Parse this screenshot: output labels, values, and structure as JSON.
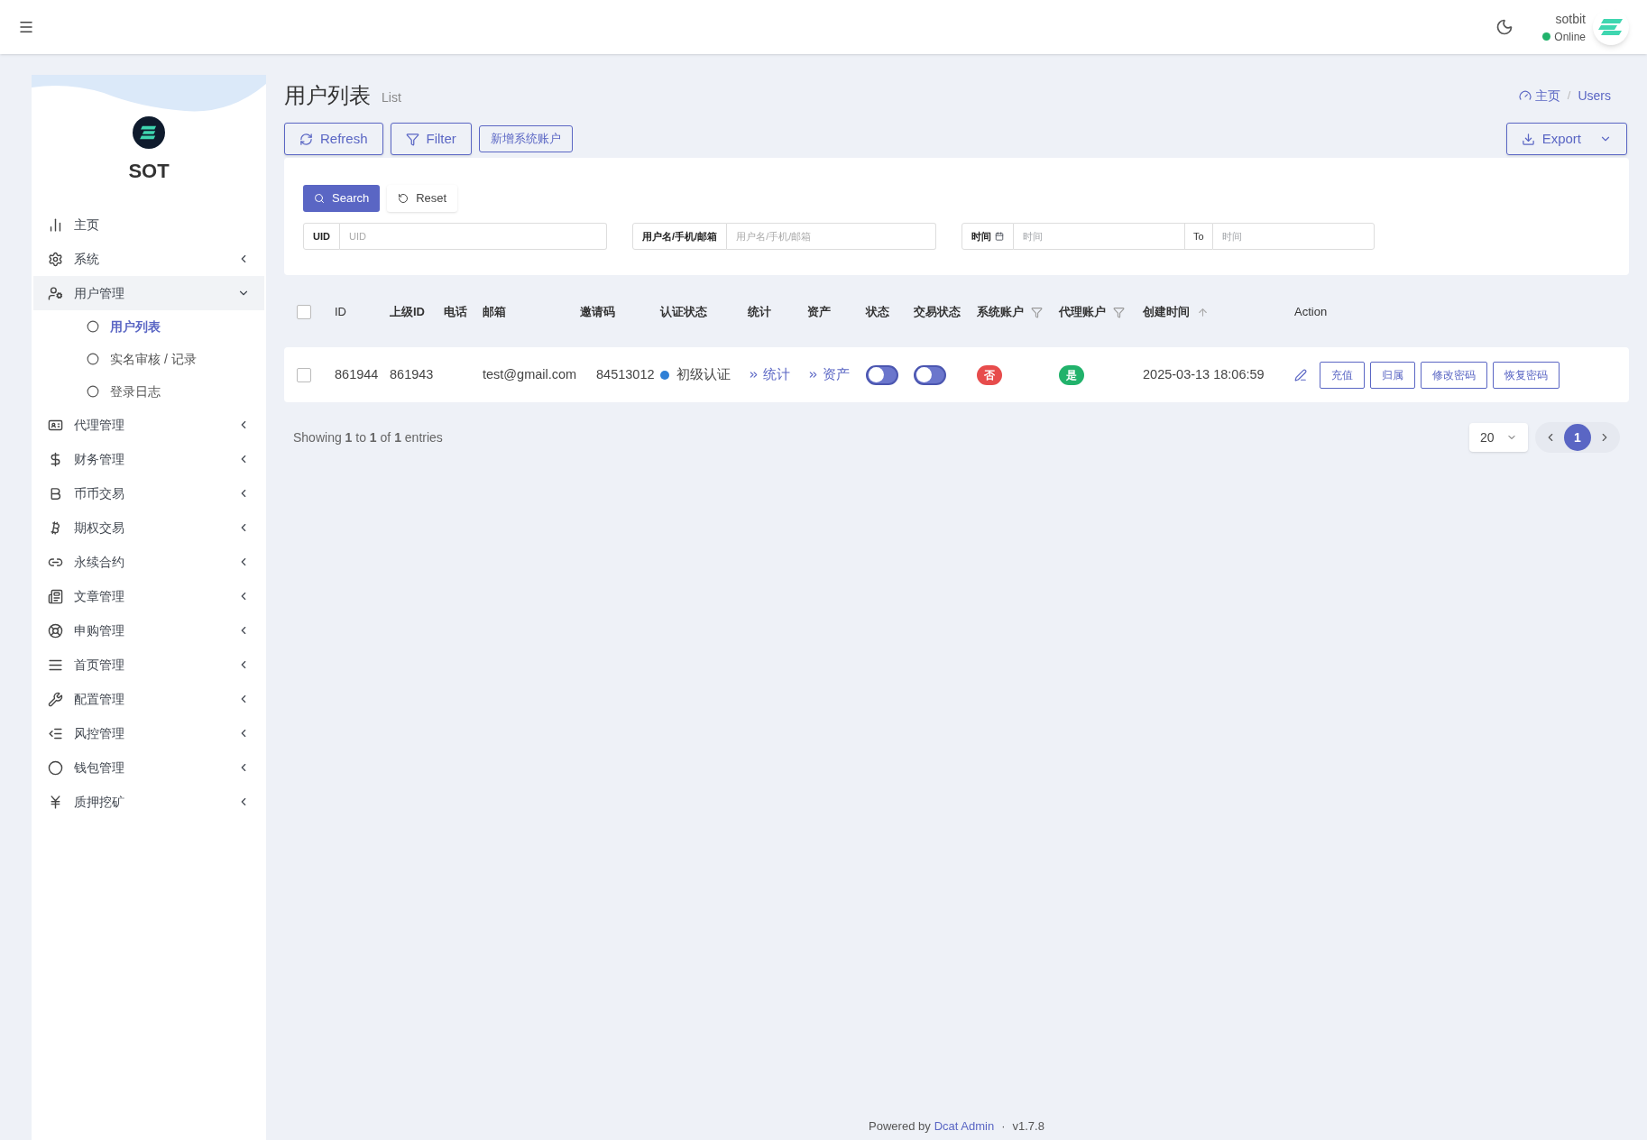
{
  "header": {
    "user_name": "sotbit",
    "user_status": "Online",
    "online": true
  },
  "sidebar": {
    "brand": "SOT",
    "items": [
      {
        "label": "主页",
        "has_children": false,
        "expanded": false,
        "selected": false
      },
      {
        "label": "系统",
        "has_children": true,
        "expanded": false,
        "selected": false
      },
      {
        "label": "用户管理",
        "has_children": true,
        "expanded": true,
        "selected": false,
        "children": [
          {
            "label": "用户列表",
            "selected": true
          },
          {
            "label": "实名审核 / 记录",
            "selected": false
          },
          {
            "label": "登录日志",
            "selected": false
          }
        ]
      },
      {
        "label": "代理管理",
        "has_children": true,
        "expanded": false,
        "selected": false
      },
      {
        "label": "财务管理",
        "has_children": true,
        "expanded": false,
        "selected": false
      },
      {
        "label": "币币交易",
        "has_children": true,
        "expanded": false,
        "selected": false
      },
      {
        "label": "期权交易",
        "has_children": true,
        "expanded": false,
        "selected": false
      },
      {
        "label": "永续合约",
        "has_children": true,
        "expanded": false,
        "selected": false
      },
      {
        "label": "文章管理",
        "has_children": true,
        "expanded": false,
        "selected": false
      },
      {
        "label": "申购管理",
        "has_children": true,
        "expanded": false,
        "selected": false
      },
      {
        "label": "首页管理",
        "has_children": true,
        "expanded": false,
        "selected": false
      },
      {
        "label": "配置管理",
        "has_children": true,
        "expanded": false,
        "selected": false
      },
      {
        "label": "风控管理",
        "has_children": true,
        "expanded": false,
        "selected": false
      },
      {
        "label": "钱包管理",
        "has_children": true,
        "expanded": false,
        "selected": false
      },
      {
        "label": "质押挖矿",
        "has_children": true,
        "expanded": false,
        "selected": false
      }
    ]
  },
  "page": {
    "title": "用户列表",
    "subtitle": "List",
    "breadcrumb": [
      "主页",
      "Users"
    ],
    "separator": "/"
  },
  "toolbar": {
    "buttons": [
      "Refresh",
      "Filter",
      "新增系统账户"
    ],
    "export": "Export"
  },
  "filter": {
    "search": "Search",
    "reset": "Reset",
    "fields": [
      {
        "label": "UID",
        "placeholder": "UID"
      },
      {
        "label": "用户名/手机/邮箱",
        "placeholder": "用户名/手机/邮箱"
      }
    ],
    "date_range": {
      "label": "时间",
      "placeholder_from": "时间",
      "to": "To",
      "placeholder_to": "时间"
    }
  },
  "table": {
    "all_checked": false,
    "columns": [
      {
        "label": "ID",
        "filter": false,
        "sort": false
      },
      {
        "label": "上级ID",
        "filter": false,
        "sort": false
      },
      {
        "label": "电话",
        "filter": false,
        "sort": false
      },
      {
        "label": "邮箱",
        "filter": false,
        "sort": false
      },
      {
        "label": "邀请码",
        "filter": false,
        "sort": false
      },
      {
        "label": "认证状态",
        "filter": false,
        "sort": false
      },
      {
        "label": "统计",
        "filter": false,
        "sort": false
      },
      {
        "label": "资产",
        "filter": false,
        "sort": false
      },
      {
        "label": "状态",
        "filter": false,
        "sort": false
      },
      {
        "label": "交易状态",
        "filter": false,
        "sort": false
      },
      {
        "label": "系统账户",
        "filter": true,
        "sort": false
      },
      {
        "label": "代理账户",
        "filter": true,
        "sort": false
      },
      {
        "label": "创建时间",
        "filter": false,
        "sort": true
      },
      {
        "label": "Action",
        "filter": false,
        "sort": false
      }
    ],
    "rows": [
      {
        "checked": false,
        "id": "861944",
        "parent_id": "861943",
        "email": "test@gmail.com",
        "invite_code": "84513012",
        "auth": {
          "label": "初级认证",
          "color": "#2f80d6"
        },
        "stats": "统计",
        "assets": "资产",
        "status_on": false,
        "trade_on": false,
        "system_account": {
          "label": "否",
          "color": "#e74c4c"
        },
        "agent_account": {
          "label": "是",
          "color": "#21b26b"
        },
        "created": "2025-03-13 18:06:59",
        "actions": [
          "充值",
          "归属",
          "修改密码",
          "恢复密码"
        ]
      }
    ]
  },
  "pagination": {
    "summary": "Showing **1** to **1** of **1** entries",
    "per_page": "20",
    "pages": [
      {
        "label": "1",
        "selected": true
      }
    ]
  },
  "footer": {
    "text": "Powered by",
    "link": "Dcat Admin",
    "separator": "·",
    "version": "v1.7.8"
  }
}
